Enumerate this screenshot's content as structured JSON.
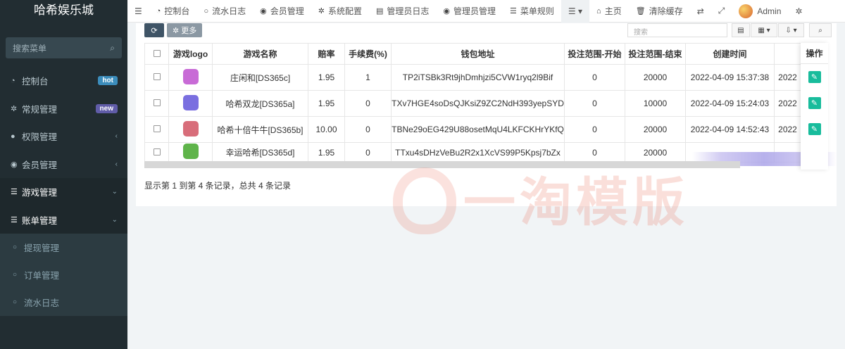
{
  "app": {
    "title": "哈希娱乐城"
  },
  "sidebar": {
    "search_placeholder": "搜索菜单",
    "items": [
      {
        "label": "控制台",
        "icon": "dashboard-icon",
        "badge": "hot"
      },
      {
        "label": "常规管理",
        "icon": "cogs-icon",
        "badge": "new"
      },
      {
        "label": "权限管理",
        "icon": "users-icon",
        "chevron": "‹"
      },
      {
        "label": "会员管理",
        "icon": "user-icon",
        "chevron": "‹"
      },
      {
        "label": "游戏管理",
        "icon": "list-icon",
        "chevron": "⌄"
      },
      {
        "label": "账单管理",
        "icon": "list-icon",
        "chevron": "⌄"
      }
    ],
    "subitems": [
      {
        "label": "提现管理"
      },
      {
        "label": "订单管理"
      },
      {
        "label": "流水日志"
      }
    ]
  },
  "topnav": {
    "items": [
      {
        "label": "控制台",
        "icon": "dashboard-icon"
      },
      {
        "label": "流水日志",
        "icon": "circle-icon"
      },
      {
        "label": "会员管理",
        "icon": "user-icon"
      },
      {
        "label": "系统配置",
        "icon": "gear-icon"
      },
      {
        "label": "管理员日志",
        "icon": "list-icon"
      },
      {
        "label": "管理员管理",
        "icon": "user-icon"
      },
      {
        "label": "菜单规则",
        "icon": "menu-icon"
      }
    ],
    "home": "主页",
    "clear_cache": "清除缓存",
    "user": "Admin"
  },
  "toolbar": {
    "more_label": "更多",
    "search_placeholder": "搜索"
  },
  "table": {
    "headers": [
      "游戏logo",
      "游戏名称",
      "赔率",
      "手续费(%)",
      "钱包地址",
      "投注范围-开始",
      "投注范围-结束",
      "创建时间",
      ""
    ],
    "ops_header": "操作",
    "rows": [
      {
        "name": "庄闲和[DS365c]",
        "odds": "1.95",
        "fee": "1",
        "wallet": "TP2iTSBk3Rt9jhDmhjzi5CVW1ryq2l9Bif",
        "min": "0",
        "max": "20000",
        "created": "2022-04-09 15:37:38",
        "updated": "2022",
        "logo_color": "#c86bd6"
      },
      {
        "name": "哈希双龙[DS365a]",
        "odds": "1.95",
        "fee": "0",
        "wallet": "TXv7HGE4soDsQJKsiZ9ZC2NdH393yepSYD",
        "min": "0",
        "max": "10000",
        "created": "2022-04-09 15:24:03",
        "updated": "2022",
        "logo_color": "#7a6fe0"
      },
      {
        "name": "哈希十倍牛牛[DS365b]",
        "odds": "10.00",
        "fee": "0",
        "wallet": "TBNe29oEG429U88osetMqU4LKFCKHrYKfQ",
        "min": "0",
        "max": "20000",
        "created": "2022-04-09 14:52:43",
        "updated": "2022",
        "logo_color": "#d86d7a"
      },
      {
        "name": "幸运哈希[DS365d]",
        "odds": "1.95",
        "fee": "0",
        "wallet": "TTxu4sDHzVeBu2R2x1XcVS99P5Kpsj7bZx",
        "min": "0",
        "max": "20000",
        "created": "",
        "updated": "",
        "logo_color": "#5fb44a"
      }
    ]
  },
  "footer": {
    "summary": "显示第 1 到第 4 条记录，总共 4 条记录"
  },
  "watermark": {
    "text": "一淘模版"
  },
  "colors": {
    "sidebar_bg": "#222d32",
    "accent": "#18bc9c",
    "hot": "#3c8dbc",
    "new": "#605ca8"
  }
}
